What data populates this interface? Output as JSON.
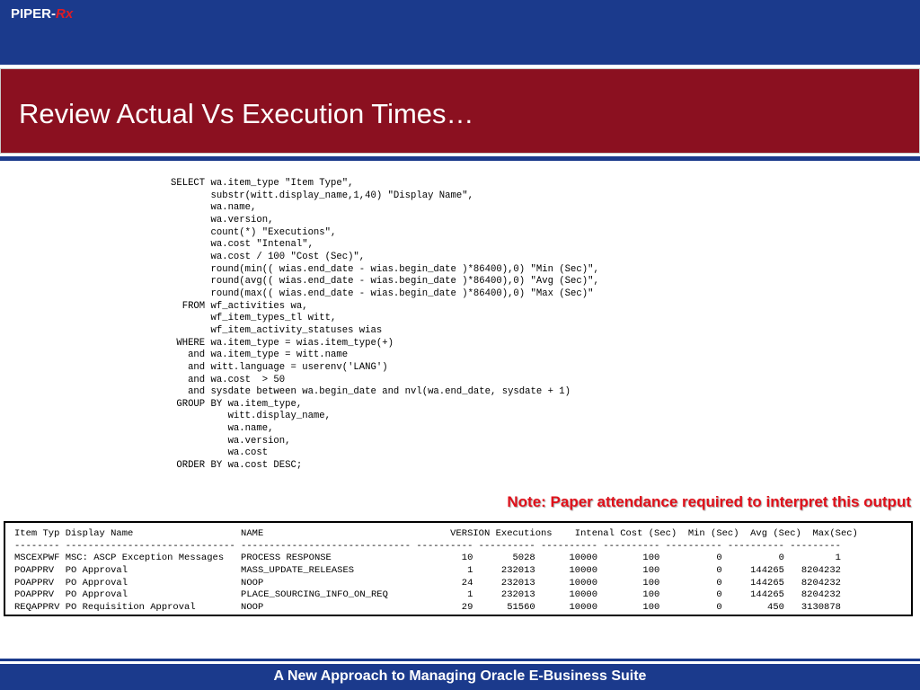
{
  "header": {
    "brand_prefix": "PIPER-",
    "brand_suffix": "Rx"
  },
  "slide": {
    "title": "Review Actual Vs Execution Times…"
  },
  "sql_lines": [
    "SELECT wa.item_type \"Item Type\",",
    "       substr(witt.display_name,1,40) \"Display Name\",",
    "       wa.name,",
    "       wa.version,",
    "       count(*) \"Executions\",",
    "       wa.cost \"Intenal\",",
    "       wa.cost / 100 \"Cost (Sec)\",",
    "       round(min(( wias.end_date - wias.begin_date )*86400),0) \"Min (Sec)\",",
    "       round(avg(( wias.end_date - wias.begin_date )*86400),0) \"Avg (Sec)\",",
    "       round(max(( wias.end_date - wias.begin_date )*86400),0) \"Max (Sec)\"",
    "  FROM wf_activities wa,",
    "       wf_item_types_tl witt,",
    "       wf_item_activity_statuses wias",
    " WHERE wa.item_type = wias.item_type(+)",
    "   and wa.item_type = witt.name",
    "   and witt.language = userenv('LANG')",
    "   and wa.cost  > 50",
    "   and sysdate between wa.begin_date and nvl(wa.end_date, sysdate + 1)",
    " GROUP BY wa.item_type,",
    "          witt.display_name,",
    "          wa.name,",
    "          wa.version,",
    "          wa.cost",
    " ORDER BY wa.cost DESC;"
  ],
  "note": "Note: Paper attendance required to interpret this output",
  "results_lines": [
    "Item Typ Display Name                   NAME                                 VERSION Executions    Intenal Cost (Sec)  Min (Sec)  Avg (Sec)  Max(Sec)",
    "-------- ------------------------------ ------------------------------ ---------- ---------- ---------- ---------- ---------- ---------- ---------",
    "MSCEXPWF MSC: ASCP Exception Messages   PROCESS RESPONSE                       10       5028      10000        100          0          0         1",
    "POAPPRV  PO Approval                    MASS_UPDATE_RELEASES                    1     232013      10000        100          0     144265   8204232",
    "POAPPRV  PO Approval                    NOOP                                   24     232013      10000        100          0     144265   8204232",
    "POAPPRV  PO Approval                    PLACE_SOURCING_INFO_ON_REQ              1     232013      10000        100          0     144265   8204232",
    "REQAPPRV PO Requisition Approval        NOOP                                   29      51560      10000        100          0        450   3130878"
  ],
  "footer": {
    "text": "A New Approach to Managing Oracle E-Business Suite"
  },
  "colors": {
    "header_blue": "#1b3a8c",
    "title_red": "#8b1020",
    "note_red": "#e0101a",
    "brand_rx_red": "#e01b24"
  }
}
